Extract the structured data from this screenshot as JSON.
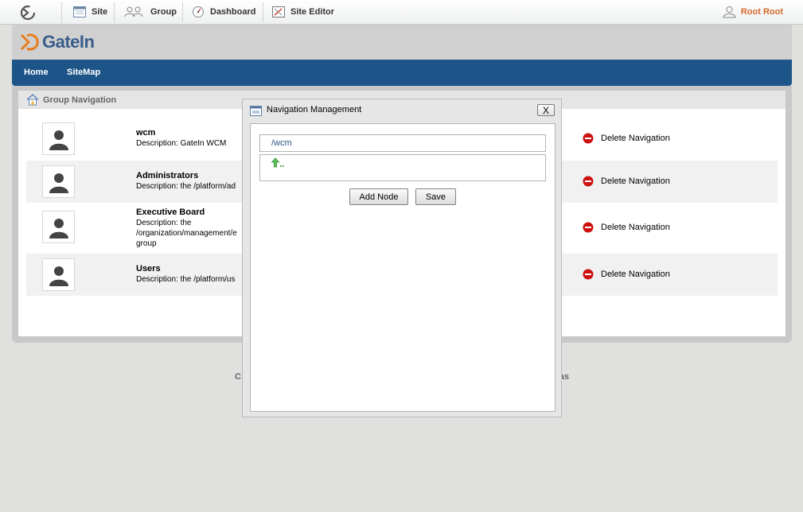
{
  "toolbar": {
    "items": [
      {
        "label": "Site",
        "icon": "site-icon"
      },
      {
        "label": "Group",
        "icon": "group-icon"
      },
      {
        "label": "Dashboard",
        "icon": "dashboard-icon"
      },
      {
        "label": "Site Editor",
        "icon": "site-editor-icon"
      }
    ],
    "user": "Root Root"
  },
  "brand": {
    "name": "GateIn"
  },
  "nav": {
    "items": [
      "Home",
      "SiteMap"
    ]
  },
  "panel": {
    "title": "Group Navigation"
  },
  "groups": [
    {
      "name": "wcm",
      "description": "Description: GateIn WCM",
      "action": "Delete Navigation"
    },
    {
      "name": "Administrators",
      "description": "Description: the /platform/ad",
      "action": "Delete Navigation"
    },
    {
      "name": "Executive Board",
      "description": "Description: the\n/organization/management/e\ngroup",
      "action": "Delete Navigation"
    },
    {
      "name": "Users",
      "description": "Description: the /platform/us",
      "action": "Delete Navigation"
    }
  ],
  "footer": {
    "left": "C",
    "right": "as"
  },
  "modal": {
    "title": "Navigation Management",
    "close": "X",
    "node_path": "/wcm",
    "buttons": {
      "add": "Add Node",
      "save": "Save"
    }
  },
  "colors": {
    "nav_bar": "#1e5589",
    "user_link": "#d4672a",
    "delete_icon": "#cc1111"
  }
}
